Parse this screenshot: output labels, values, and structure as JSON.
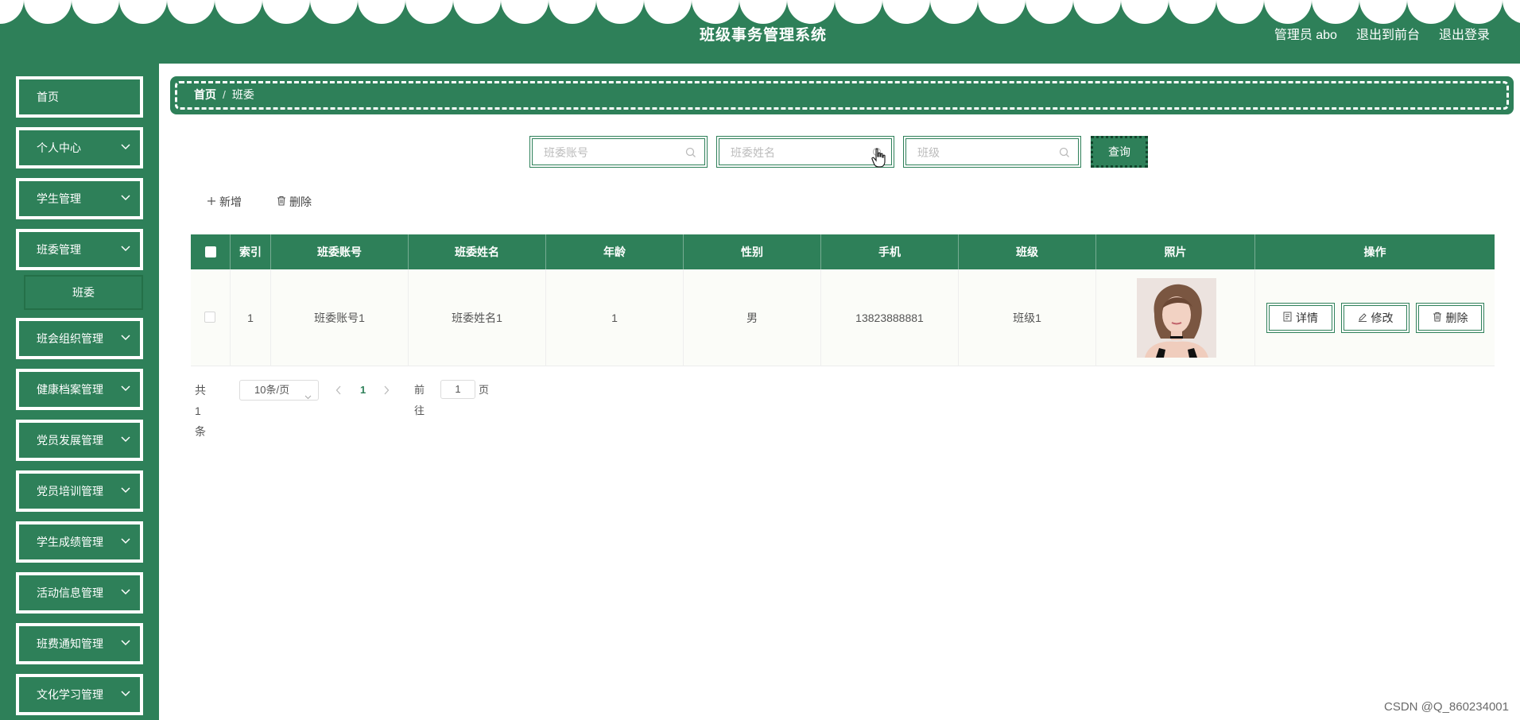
{
  "header": {
    "title": "班级事务管理系统",
    "admin_label": "管理员 abo",
    "front_link": "退出到前台",
    "logout_link": "退出登录"
  },
  "sidebar": {
    "items": [
      {
        "label": "首页",
        "has_children": false
      },
      {
        "label": "个人中心",
        "has_children": true
      },
      {
        "label": "学生管理",
        "has_children": true
      },
      {
        "label": "班委管理",
        "has_children": true
      },
      {
        "label": "班会组织管理",
        "has_children": true
      },
      {
        "label": "健康档案管理",
        "has_children": true
      },
      {
        "label": "党员发展管理",
        "has_children": true
      },
      {
        "label": "党员培训管理",
        "has_children": true
      },
      {
        "label": "学生成绩管理",
        "has_children": true
      },
      {
        "label": "活动信息管理",
        "has_children": true
      },
      {
        "label": "班费通知管理",
        "has_children": true
      },
      {
        "label": "文化学习管理",
        "has_children": true
      }
    ],
    "active_sub": "班委"
  },
  "breadcrumb": {
    "home": "首页",
    "separator": "/",
    "current": "班委"
  },
  "search": {
    "account_placeholder": "班委账号",
    "name_placeholder": "班委姓名",
    "class_placeholder": "班级",
    "query_label": "查询"
  },
  "actions": {
    "add_label": "新增",
    "delete_label": "删除"
  },
  "table": {
    "columns": [
      "索引",
      "班委账号",
      "班委姓名",
      "年龄",
      "性别",
      "手机",
      "班级",
      "照片",
      "操作"
    ],
    "rows": [
      {
        "index": "1",
        "account": "班委账号1",
        "name": "班委姓名1",
        "age": "1",
        "gender": "男",
        "phone": "13823888881",
        "class": "班级1"
      }
    ],
    "row_actions": {
      "detail": "详情",
      "edit": "修改",
      "delete": "删除"
    }
  },
  "pagination": {
    "total_text": "共 1 条",
    "page_size": "10条/页",
    "current_page": "1",
    "goto_label": "前往",
    "goto_value": "1",
    "page_suffix": "页"
  },
  "watermark": "CSDN @Q_860234001",
  "colors": {
    "primary": "#2e8059",
    "header_text": "#ffffff"
  }
}
